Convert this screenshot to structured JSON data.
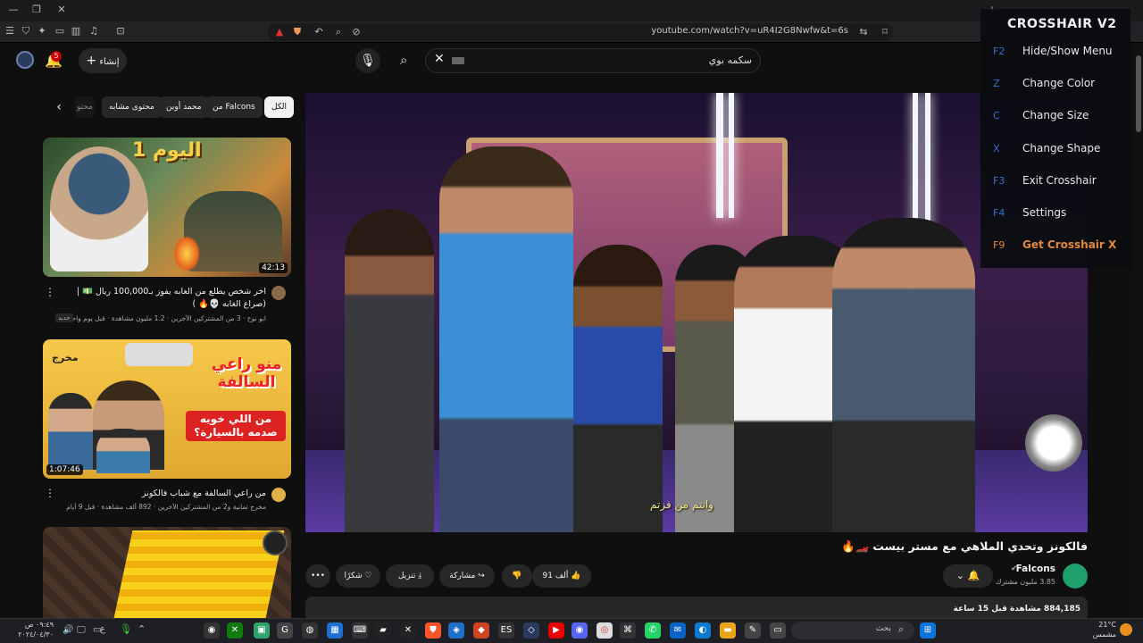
{
  "browser": {
    "url": "youtube.com/watch?v=uR4I2G8Nwfw&t=6s"
  },
  "header": {
    "search_value": "سكمه بوي",
    "create_label": "إنشاء",
    "notif_count": "5"
  },
  "chips": [
    "الكل",
    "من Falcons",
    "محمد أوبن",
    "محتوى مشابه",
    "محتو"
  ],
  "recommendations": [
    {
      "title": "اخر شخص يطلع من الغابه يفوز بـ100,000 ريال 💵 |(صراع الغابه 💀🔥 )",
      "channel": "ابو نوح",
      "meta": "ابو نوح · 3 من المشتركين الآخرين · 1.2 مليون مشاهدة · قبل يوم واحد",
      "badge": "جديد",
      "duration": "42:13",
      "thumb_text": "اليوم 1"
    },
    {
      "title": "من راعي السالفة مع شباب فالكونز",
      "channel": "مخرج ثمانية",
      "meta": "مخرج ثمانية و2 من المشتركين الآخرين · 892 ألف مشاهدة · قبل 9 أيام",
      "duration": "1:07:46",
      "thumb_text": "منو راعي السالفة",
      "thumb_sub": "من اللي خويه صدمه بالسيارة؟",
      "thumb_brand": "مخرج"
    },
    {
      "title": "",
      "meta": ""
    }
  ],
  "player": {
    "caption": "وانتم من فزتم"
  },
  "video": {
    "title": "فالكونز وتحدي الملاهي مع مستر بيست 🏎️🔥",
    "channel": "Falcons",
    "subscribers": "3.85 مليون مشترك",
    "likes": "91 ألف",
    "share_label": "مشاركة",
    "download_label": "تنزيل",
    "thanks_label": "شكرًا",
    "views_time": "884,185 مشاهدة قبل 15 ساعة"
  },
  "crosshair": {
    "title": "CROSSHAIR V2",
    "items": [
      {
        "key": "F2",
        "label": "Hide/Show Menu"
      },
      {
        "key": "Z",
        "label": "Change Color"
      },
      {
        "key": "C",
        "label": "Change Size"
      },
      {
        "key": "X",
        "label": "Change Shape"
      },
      {
        "key": "F3",
        "label": "Exit Crosshair"
      },
      {
        "key": "F4",
        "label": "Settings"
      },
      {
        "key": "F9",
        "label": "Get Crosshair X"
      }
    ]
  },
  "taskbar": {
    "time": "٠٩:٤٩ ص",
    "date": "٢٠٢٤/٠٤/٣٠",
    "search_placeholder": "بحث",
    "weather_temp": "21°C",
    "weather_desc": "مشمس",
    "lang": "ع"
  },
  "colors": {
    "accent_red": "#cc0000",
    "crosshair_key": "#3d6fc7",
    "crosshair_highlight": "#e58a3c"
  }
}
